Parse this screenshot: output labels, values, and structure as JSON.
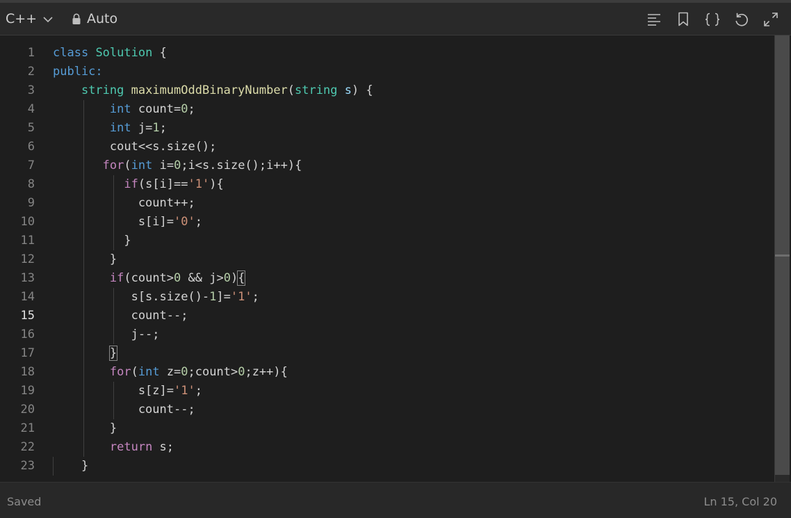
{
  "toolbar": {
    "language": "C++",
    "mode": "Auto",
    "icons": [
      "menu-lines-icon",
      "bookmark-icon",
      "braces-icon",
      "undo-icon",
      "expand-icon"
    ]
  },
  "editor": {
    "active_line": 15,
    "lines": [
      {
        "n": "1",
        "tokens": [
          [
            "class",
            "kw"
          ],
          [
            " ",
            "pl"
          ],
          [
            "Solution",
            "cls"
          ],
          [
            " {",
            "pl"
          ]
        ]
      },
      {
        "n": "2",
        "tokens": [
          [
            "public:",
            "kw"
          ]
        ]
      },
      {
        "n": "3",
        "tokens": [
          [
            "    ",
            "pl"
          ],
          [
            "string",
            "cls"
          ],
          [
            " ",
            "pl"
          ],
          [
            "maximumOddBinaryNumber",
            "fn"
          ],
          [
            "(",
            "pl"
          ],
          [
            "string",
            "cls"
          ],
          [
            " ",
            "pl"
          ],
          [
            "s",
            "id"
          ],
          [
            ") {",
            "pl"
          ]
        ]
      },
      {
        "n": "4",
        "tokens": [
          [
            "        ",
            "pl"
          ],
          [
            "int",
            "kw"
          ],
          [
            " count=",
            "pl"
          ],
          [
            "0",
            "num"
          ],
          [
            ";",
            "pl"
          ]
        ]
      },
      {
        "n": "5",
        "tokens": [
          [
            "        ",
            "pl"
          ],
          [
            "int",
            "kw"
          ],
          [
            " j=",
            "pl"
          ],
          [
            "1",
            "num"
          ],
          [
            ";",
            "pl"
          ]
        ]
      },
      {
        "n": "6",
        "tokens": [
          [
            "        cout<<s.size();",
            "pl"
          ]
        ]
      },
      {
        "n": "7",
        "tokens": [
          [
            "       ",
            "pl"
          ],
          [
            "for",
            "ctl"
          ],
          [
            "(",
            "pl"
          ],
          [
            "int",
            "kw"
          ],
          [
            " i=",
            "pl"
          ],
          [
            "0",
            "num"
          ],
          [
            ";i<s.size();i++){",
            "pl"
          ]
        ]
      },
      {
        "n": "8",
        "tokens": [
          [
            "          ",
            "pl"
          ],
          [
            "if",
            "ctl"
          ],
          [
            "(s[i]==",
            "pl"
          ],
          [
            "'1'",
            "str"
          ],
          [
            "){",
            "pl"
          ]
        ]
      },
      {
        "n": "9",
        "tokens": [
          [
            "            count++;",
            "pl"
          ]
        ]
      },
      {
        "n": "10",
        "tokens": [
          [
            "            s[i]=",
            "pl"
          ],
          [
            "'0'",
            "str"
          ],
          [
            ";",
            "pl"
          ]
        ]
      },
      {
        "n": "11",
        "tokens": [
          [
            "          }",
            "pl"
          ]
        ]
      },
      {
        "n": "12",
        "tokens": [
          [
            "        }",
            "pl"
          ]
        ]
      },
      {
        "n": "13",
        "tokens": [
          [
            "        ",
            "pl"
          ],
          [
            "if",
            "ctl"
          ],
          [
            "(count>",
            "pl"
          ],
          [
            "0",
            "num"
          ],
          [
            " && j>",
            "pl"
          ],
          [
            "0",
            "num"
          ],
          [
            ")",
            "pl"
          ],
          [
            "{",
            "bm"
          ]
        ]
      },
      {
        "n": "14",
        "tokens": [
          [
            "           s[s.size()-",
            "pl"
          ],
          [
            "1",
            "num"
          ],
          [
            "]=",
            "pl"
          ],
          [
            "'1'",
            "str"
          ],
          [
            ";",
            "pl"
          ]
        ]
      },
      {
        "n": "15",
        "tokens": [
          [
            "           count--;",
            "pl"
          ]
        ]
      },
      {
        "n": "16",
        "tokens": [
          [
            "           j--;",
            "pl"
          ]
        ]
      },
      {
        "n": "17",
        "tokens": [
          [
            "        ",
            "pl"
          ],
          [
            "}",
            "bm"
          ]
        ]
      },
      {
        "n": "18",
        "tokens": [
          [
            "        ",
            "pl"
          ],
          [
            "for",
            "ctl"
          ],
          [
            "(",
            "pl"
          ],
          [
            "int",
            "kw"
          ],
          [
            " z=",
            "pl"
          ],
          [
            "0",
            "num"
          ],
          [
            ";count>",
            "pl"
          ],
          [
            "0",
            "num"
          ],
          [
            ";z++){",
            "pl"
          ]
        ]
      },
      {
        "n": "19",
        "tokens": [
          [
            "            s[z]=",
            "pl"
          ],
          [
            "'1'",
            "str"
          ],
          [
            ";",
            "pl"
          ]
        ]
      },
      {
        "n": "20",
        "tokens": [
          [
            "            count--;",
            "pl"
          ]
        ]
      },
      {
        "n": "21",
        "tokens": [
          [
            "        }",
            "pl"
          ]
        ]
      },
      {
        "n": "22",
        "tokens": [
          [
            "        ",
            "pl"
          ],
          [
            "return",
            "ctl"
          ],
          [
            " s;",
            "pl"
          ]
        ]
      },
      {
        "n": "23",
        "tokens": [
          [
            "    }",
            "pl"
          ]
        ]
      }
    ]
  },
  "status": {
    "saved": "Saved",
    "cursor": "Ln 15, Col 20"
  }
}
